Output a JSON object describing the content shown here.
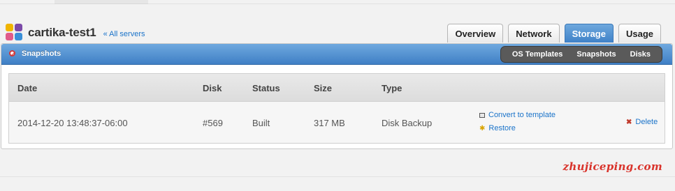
{
  "server": {
    "name": "cartika-test1",
    "all_servers_link": "« All servers"
  },
  "main_tabs": [
    {
      "label": "Overview",
      "active": false
    },
    {
      "label": "Network",
      "active": false
    },
    {
      "label": "Storage",
      "active": true
    },
    {
      "label": "Usage",
      "active": false
    }
  ],
  "panel": {
    "title": "Snapshots",
    "subnav": [
      "OS Templates",
      "Snapshots",
      "Disks"
    ]
  },
  "table": {
    "columns": [
      "Date",
      "Disk",
      "Status",
      "Size",
      "Type"
    ],
    "rows": [
      {
        "date": "2014-12-20 13:48:37-06:00",
        "disk": "#569",
        "status": "Built",
        "size": "317 MB",
        "type": "Disk Backup",
        "actions": {
          "convert": "Convert to template",
          "restore": "Restore",
          "delete": "Delete"
        }
      }
    ]
  },
  "watermark": "zhujiceping.com",
  "colors": {
    "accent_blue": "#3f82c8",
    "link": "#1a73c9",
    "delete_red": "#c0392b",
    "watermark_red": "#d9332b"
  }
}
